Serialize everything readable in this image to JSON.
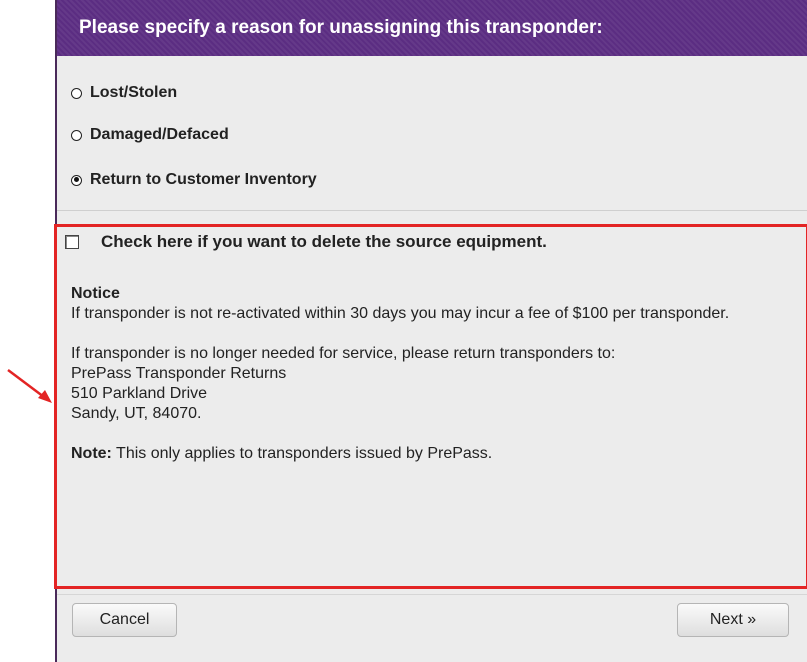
{
  "dialog": {
    "title": "Please specify a reason for unassigning this transponder:",
    "reasons": [
      {
        "label": "Lost/Stolen",
        "selected": false
      },
      {
        "label": "Damaged/Defaced",
        "selected": false
      },
      {
        "label": "Return to Customer Inventory",
        "selected": true
      }
    ],
    "delete_checkbox": {
      "label": "Check here if you want to delete the source equipment.",
      "checked": false
    },
    "notice": {
      "title": "Notice",
      "text1": "If transponder is not re-activated within 30 days you may incur a fee of $100 per transponder.",
      "text2": "If transponder is no longer needed for service, please return transponders to:",
      "address_line1": "PrePass Transponder Returns",
      "address_line2": "510 Parkland Drive",
      "address_line3": "Sandy, UT, 84070.",
      "note_label": "Note:",
      "note_text": " This only applies to transponders issued by PrePass."
    },
    "buttons": {
      "cancel": "Cancel",
      "next": "Next »"
    }
  },
  "colors": {
    "header_bg": "#5b2d82",
    "highlight": "#e32424",
    "panel_bg": "#ececec"
  }
}
